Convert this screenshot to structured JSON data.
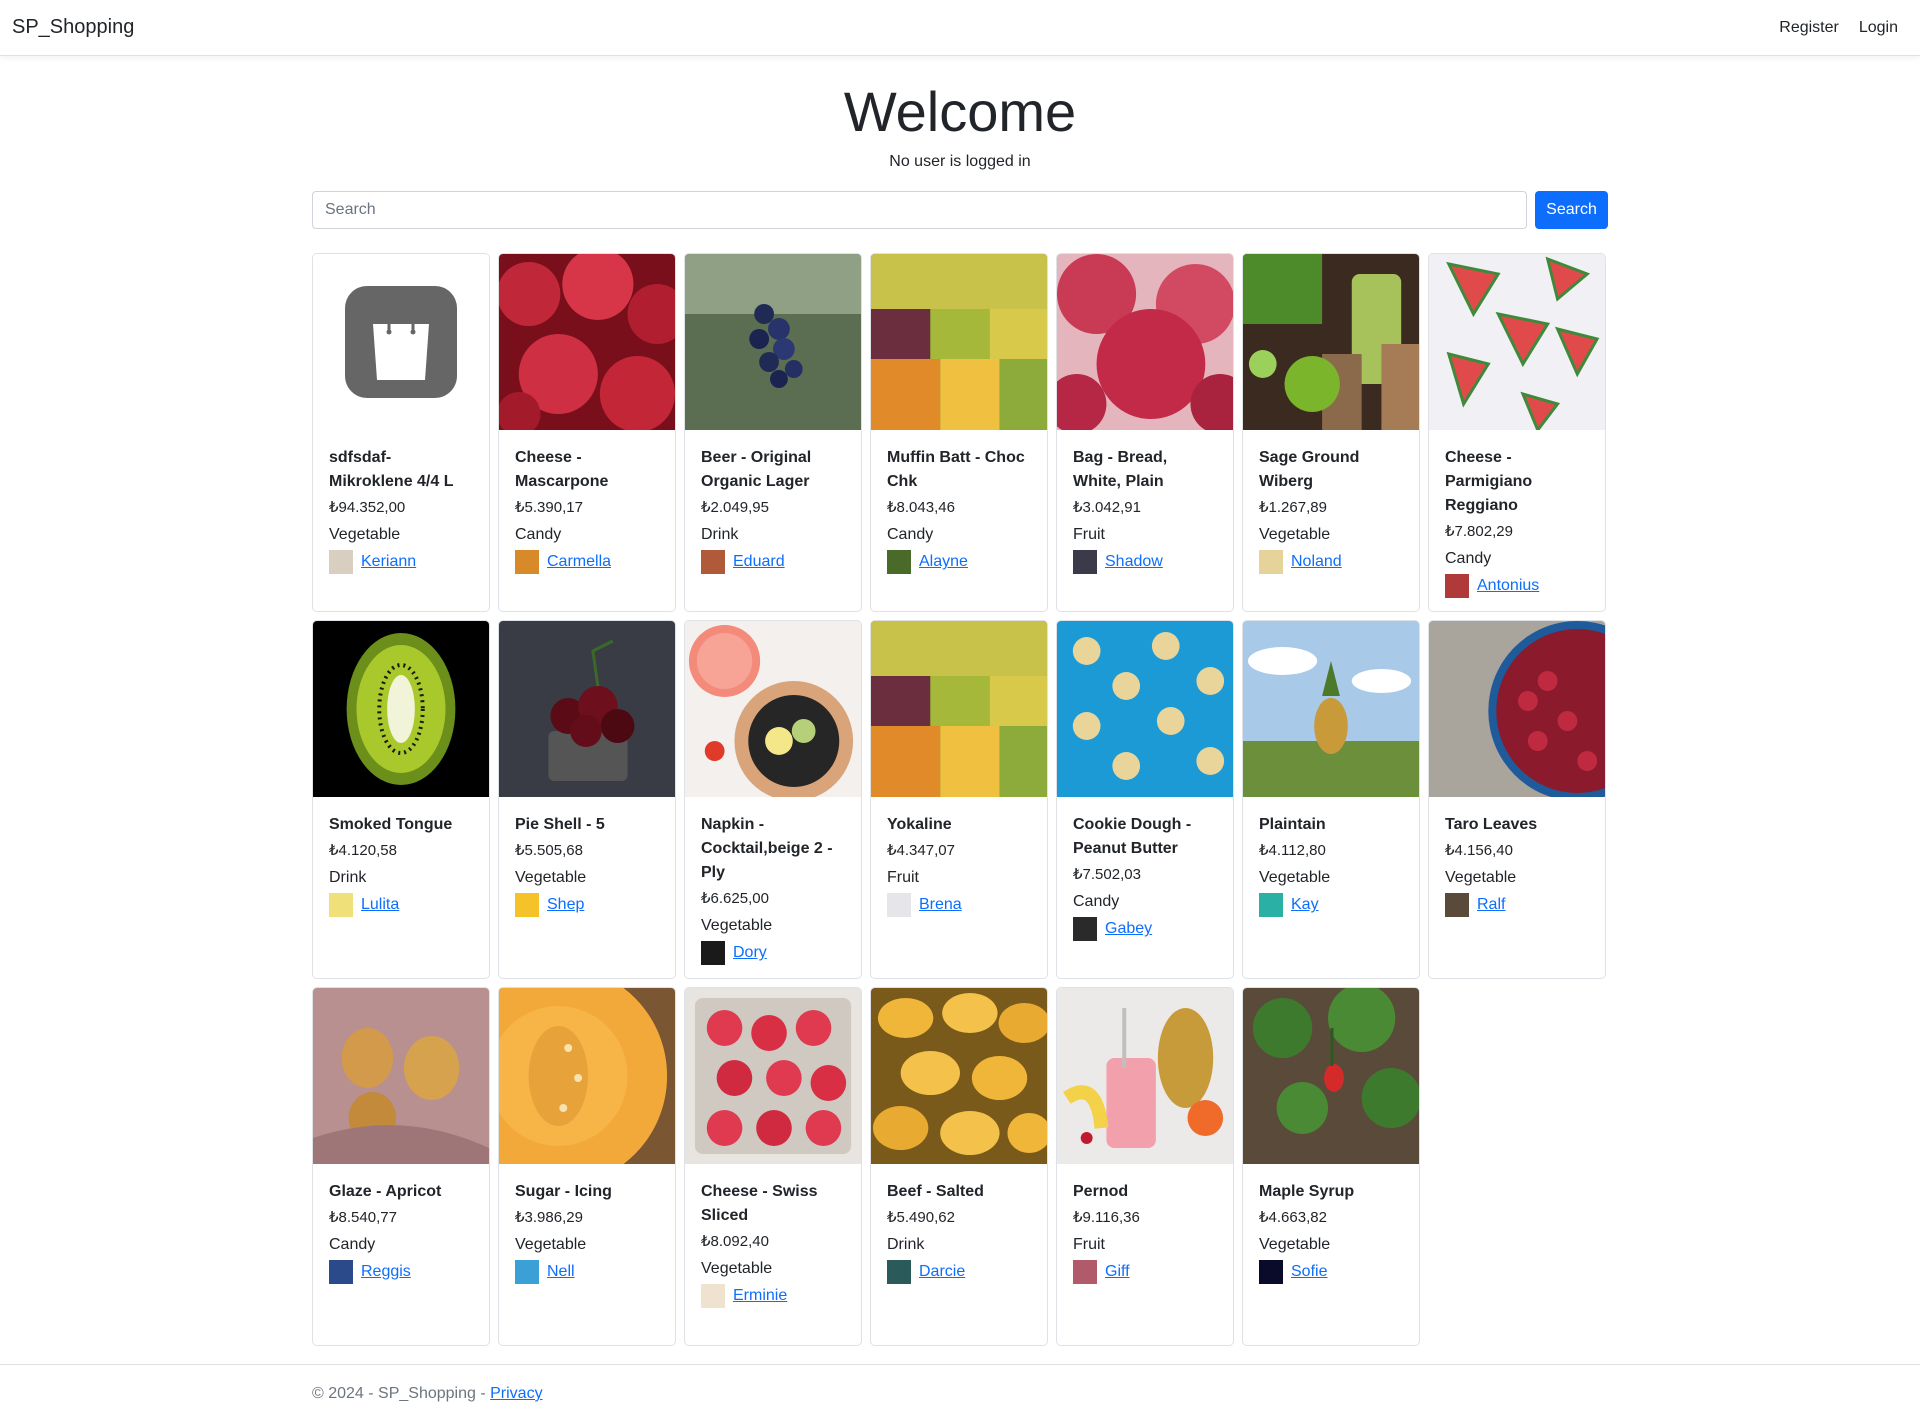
{
  "navbar": {
    "brand": "SP_Shopping",
    "register": "Register",
    "login": "Login"
  },
  "hero": {
    "title": "Welcome",
    "subtitle": "No user is logged in"
  },
  "search": {
    "placeholder": "Search",
    "button": "Search"
  },
  "products": [
    {
      "name": "sdfsdaf-Mikroklene 4/4 L",
      "price": "₺94.352,00",
      "category": "Vegetable",
      "owner": "Keriann",
      "image": "shopping-bag-icon"
    },
    {
      "name": "Cheese - Mascarpone",
      "price": "₺5.390,17",
      "category": "Candy",
      "owner": "Carmella",
      "image": "raspberries-photo"
    },
    {
      "name": "Beer - Original Organic Lager",
      "price": "₺2.049,95",
      "category": "Drink",
      "owner": "Eduard",
      "image": "blueberries-photo"
    },
    {
      "name": "Muffin Batt - Choc Chk",
      "price": "₺8.043,46",
      "category": "Candy",
      "owner": "Alayne",
      "image": "fruit-market-photo"
    },
    {
      "name": "Bag - Bread, White, Plain",
      "price": "₺3.042,91",
      "category": "Fruit",
      "owner": "Shadow",
      "image": "raspberry-closeup-photo"
    },
    {
      "name": "Sage Ground Wiberg",
      "price": "₺1.267,89",
      "category": "Vegetable",
      "owner": "Noland",
      "image": "green-smoothie-photo"
    },
    {
      "name": "Cheese - Parmigiano Reggiano",
      "price": "₺7.802,29",
      "category": "Candy",
      "owner": "Antonius",
      "image": "watermelon-slices-photo"
    },
    {
      "name": "Smoked Tongue",
      "price": "₺4.120,58",
      "category": "Drink",
      "owner": "Lulita",
      "image": "kiwi-photo"
    },
    {
      "name": "Pie Shell - 5",
      "price": "₺5.505,68",
      "category": "Vegetable",
      "owner": "Shep",
      "image": "cherries-photo"
    },
    {
      "name": "Napkin - Cocktail,beige 2 - Ply",
      "price": "₺6.625,00",
      "category": "Vegetable",
      "owner": "Dory",
      "image": "grapefruit-plate-photo"
    },
    {
      "name": "Yokaline",
      "price": "₺4.347,07",
      "category": "Fruit",
      "owner": "Brena",
      "image": "fruit-market-photo"
    },
    {
      "name": "Cookie Dough - Peanut Butter",
      "price": "₺7.502,03",
      "category": "Candy",
      "owner": "Gabey",
      "image": "banana-slices-photo"
    },
    {
      "name": "Plaintain",
      "price": "₺4.112,80",
      "category": "Vegetable",
      "owner": "Kay",
      "image": "pineapple-field-photo"
    },
    {
      "name": "Taro Leaves",
      "price": "₺4.156,40",
      "category": "Vegetable",
      "owner": "Ralf",
      "image": "cranberries-bowl-photo"
    },
    {
      "name": "Glaze - Apricot",
      "price": "₺8.540,77",
      "category": "Candy",
      "owner": "Reggis",
      "image": "pears-photo"
    },
    {
      "name": "Sugar - Icing",
      "price": "₺3.986,29",
      "category": "Vegetable",
      "owner": "Nell",
      "image": "cantaloupe-photo"
    },
    {
      "name": "Cheese - Swiss Sliced",
      "price": "₺8.092,40",
      "category": "Vegetable",
      "owner": "Erminie",
      "image": "raspberry-basket-photo"
    },
    {
      "name": "Beef - Salted",
      "price": "₺5.490,62",
      "category": "Drink",
      "owner": "Darcie",
      "image": "mangoes-photo"
    },
    {
      "name": "Pernod",
      "price": "₺9.116,36",
      "category": "Fruit",
      "owner": "Giff",
      "image": "pink-smoothie-photo"
    },
    {
      "name": "Maple Syrup",
      "price": "₺4.663,82",
      "category": "Vegetable",
      "owner": "Sofie",
      "image": "strawberry-plant-photo"
    }
  ],
  "footer": {
    "copyright": "© 2024 - SP_Shopping - ",
    "privacy": "Privacy"
  }
}
